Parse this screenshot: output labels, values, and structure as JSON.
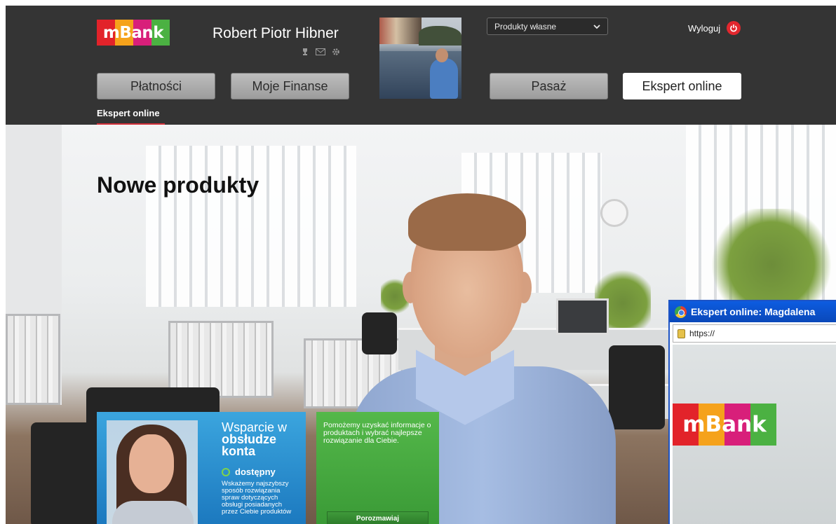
{
  "brand": {
    "logo_text": "mBank",
    "logo_colors": [
      "#e2232a",
      "#f5a21b",
      "#d81f7a",
      "#4bb142"
    ]
  },
  "header": {
    "user_name": "Robert Piotr Hibner",
    "user_icons": [
      "trophy-icon",
      "mail-icon",
      "gear-icon"
    ],
    "product_select": {
      "value": "Produkty własne"
    },
    "logout_label": "Wyloguj",
    "nav": [
      {
        "label": "Płatności",
        "active": false
      },
      {
        "label": "Moje Finanse",
        "active": false
      },
      {
        "label": "Pasaż",
        "active": false
      },
      {
        "label": "Ekspert online",
        "active": true
      }
    ],
    "subnav_active": "Ekspert online",
    "colors": {
      "bar": "#343434",
      "accent": "#d4303a"
    }
  },
  "hero": {
    "title": "Nowe produkty"
  },
  "support_card": {
    "title_line1": "Wsparcie w",
    "title_line2": "obsłudze",
    "title_line3": "konta",
    "status": "dostępny",
    "description": "Wskażemy najszybszy sposób rozwiązania spraw dotyczących obsługi posiadanych przez Ciebie produktów",
    "color": "#2a8fd3"
  },
  "chat_card": {
    "text": "Pomożemy uzyskać informacje o produktach i wybrać najlepsze rozwiązanie dla Ciebie.",
    "button_label": "Porozmawiaj",
    "color": "#48aa42"
  },
  "popup": {
    "title": "Ekspert online: Magdalena",
    "url": "https://",
    "logo_text": "mBank",
    "title_color": "#0d5ce0"
  }
}
